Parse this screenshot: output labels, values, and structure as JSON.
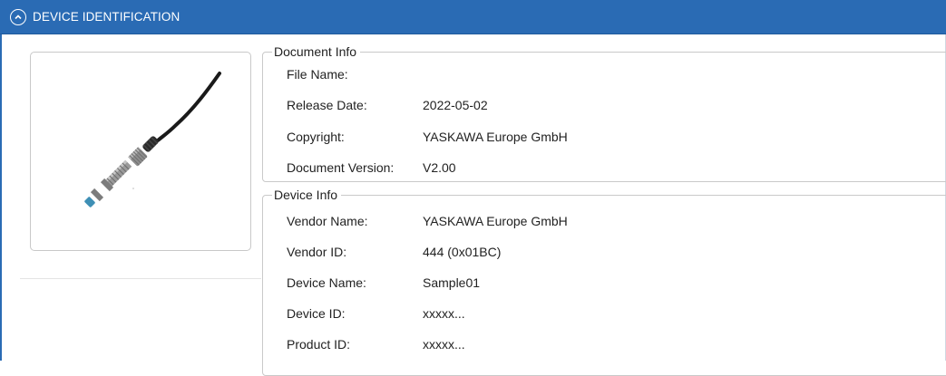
{
  "header": {
    "title": "DEVICE IDENTIFICATION",
    "collapse_icon": "chevron-up-circle-icon"
  },
  "colors": {
    "header_bg": "#2a6bb4",
    "group_border": "#c9c9c9"
  },
  "device_image": {
    "icon": "cable-connector-sensor-image"
  },
  "document_info": {
    "title": "Document Info",
    "rows": [
      {
        "label": "File Name:",
        "value": ""
      },
      {
        "label": "Release Date:",
        "value": "2022-05-02"
      },
      {
        "label": "Copyright:",
        "value": "YASKAWA Europe GmbH"
      },
      {
        "label": "Document Version:",
        "value": "V2.00"
      }
    ]
  },
  "device_info": {
    "title": "Device Info",
    "rows": [
      {
        "label": "Vendor Name:",
        "value": "YASKAWA Europe GmbH"
      },
      {
        "label": "Vendor ID:",
        "value": "444 (0x01BC)"
      },
      {
        "label": "Device Name:",
        "value": "Sample01"
      },
      {
        "label": "Device ID:",
        "value": "xxxxx..."
      },
      {
        "label": "Product ID:",
        "value": "xxxxx..."
      }
    ]
  }
}
